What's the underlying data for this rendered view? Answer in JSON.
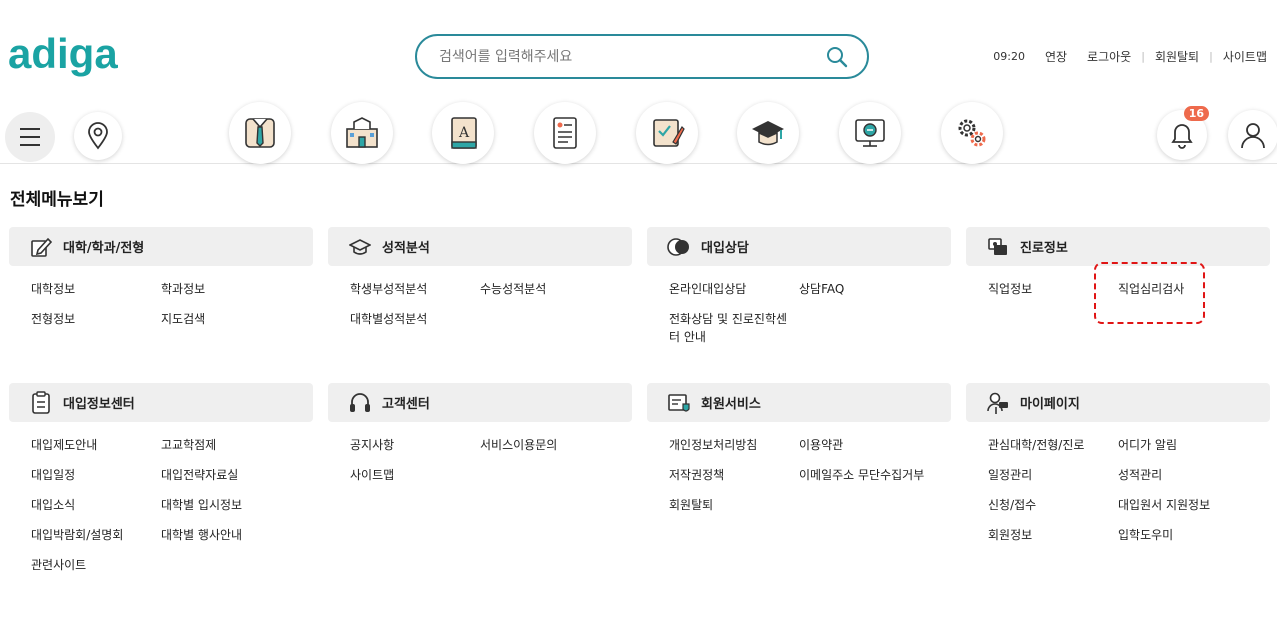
{
  "header": {
    "logo": "adiga",
    "search_placeholder": "검색어를 입력해주세요",
    "time": "09:20",
    "extend": "연장",
    "logout": "로그아웃",
    "withdraw": "회원탈퇴",
    "sitemap": "사이트맵"
  },
  "icons": {
    "notification_count": "16"
  },
  "page_title": "전체메뉴보기",
  "panels": [
    {
      "title": "대학/학과/전형",
      "icon": "edit-icon",
      "links": [
        "대학정보",
        "학과정보",
        "전형정보",
        "지도검색"
      ]
    },
    {
      "title": "성적분석",
      "icon": "graduation-cap-icon",
      "links": [
        "학생부성적분석",
        "수능성적분석",
        "대학별성적분석"
      ]
    },
    {
      "title": "대입상담",
      "icon": "chat-icon",
      "links": [
        "온라인대입상담",
        "상담FAQ",
        "전화상담 및 진로진학센터 안내"
      ]
    },
    {
      "title": "진로정보",
      "icon": "career-icon",
      "links": [
        "직업정보",
        "직업심리검사"
      ]
    },
    {
      "title": "대입정보센터",
      "icon": "clipboard-icon",
      "links": [
        "대입제도안내",
        "고교학점제",
        "대입일정",
        "대입전략자료실",
        "대입소식",
        "대학별 입시정보",
        "대입박람회/설명회",
        "대학별 행사안내",
        "관련사이트"
      ]
    },
    {
      "title": "고객센터",
      "icon": "headset-icon",
      "links": [
        "공지사항",
        "서비스이용문의",
        "사이트맵"
      ]
    },
    {
      "title": "회원서비스",
      "icon": "member-icon",
      "links": [
        "개인정보처리방침",
        "이용약관",
        "저작권정책",
        "이메일주소 무단수집거부",
        "회원탈퇴"
      ]
    },
    {
      "title": "마이페이지",
      "icon": "mypage-icon",
      "links": [
        "관심대학/전형/진로",
        "어디가 알림",
        "일정관리",
        "성적관리",
        "신청/접수",
        "대입원서 지원정보",
        "회원정보",
        "입학도우미"
      ]
    }
  ]
}
